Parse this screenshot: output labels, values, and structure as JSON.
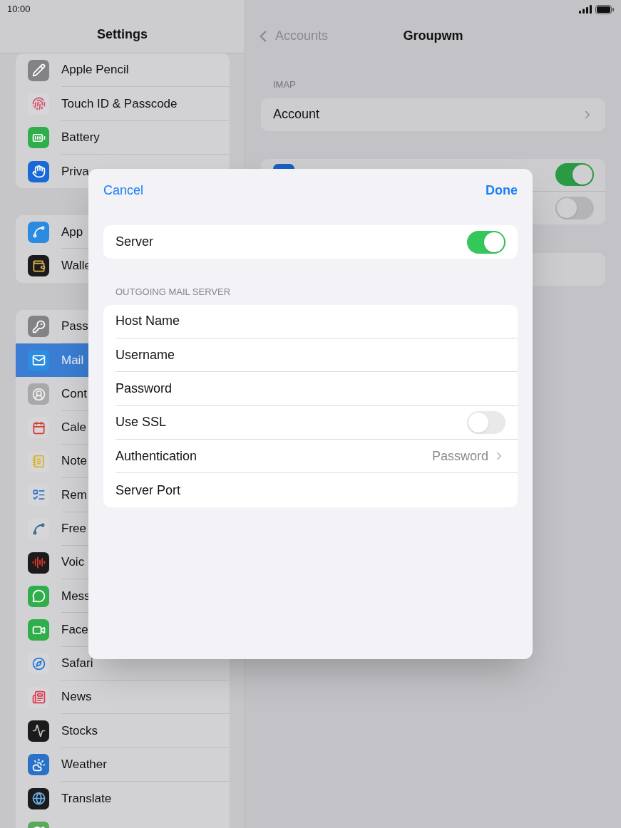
{
  "status_bar": {
    "time": "10:00"
  },
  "sidebar": {
    "title": "Settings",
    "groups": [
      {
        "items": [
          {
            "label": "Apple Pencil",
            "selected": false
          },
          {
            "label": "Touch ID & Passcode",
            "selected": false
          },
          {
            "label": "Battery",
            "selected": false
          },
          {
            "label": "Priva",
            "selected": false
          }
        ]
      },
      {
        "items": [
          {
            "label": "App",
            "selected": false
          },
          {
            "label": "Walle",
            "selected": false
          }
        ]
      },
      {
        "items": [
          {
            "label": "Pass",
            "selected": false
          },
          {
            "label": "Mail",
            "selected": true
          },
          {
            "label": "Cont",
            "selected": false
          },
          {
            "label": "Cale",
            "selected": false
          },
          {
            "label": "Note",
            "selected": false
          },
          {
            "label": "Rem",
            "selected": false
          },
          {
            "label": "Free",
            "selected": false
          },
          {
            "label": "Voic",
            "selected": false
          },
          {
            "label": "Mess",
            "selected": false
          },
          {
            "label": "Face",
            "selected": false
          },
          {
            "label": "Safari",
            "selected": false
          },
          {
            "label": "News",
            "selected": false
          },
          {
            "label": "Stocks",
            "selected": false
          },
          {
            "label": "Weather",
            "selected": false
          },
          {
            "label": "Translate",
            "selected": false
          }
        ]
      }
    ]
  },
  "detail": {
    "back": "Accounts",
    "title": "Groupwm",
    "section_header": "IMAP",
    "account_row": "Account",
    "toggle_rows": [
      {
        "on": true
      },
      {
        "on": false
      }
    ]
  },
  "sheet": {
    "cancel": "Cancel",
    "done": "Done",
    "server": {
      "label": "Server",
      "on": true
    },
    "section_header": "OUTGOING MAIL SERVER",
    "rows": [
      {
        "kind": "field",
        "label": "Host Name"
      },
      {
        "kind": "field",
        "label": "Username"
      },
      {
        "kind": "field",
        "label": "Password"
      },
      {
        "kind": "toggle",
        "label": "Use SSL",
        "on": false
      },
      {
        "kind": "link",
        "label": "Authentication",
        "value": "Password"
      },
      {
        "kind": "field",
        "label": "Server Port"
      }
    ]
  }
}
